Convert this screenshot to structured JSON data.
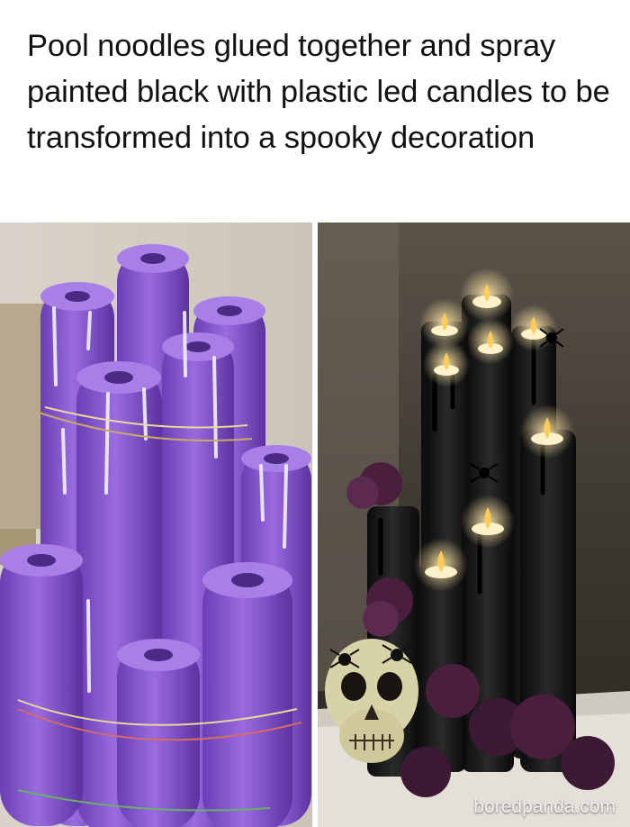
{
  "post": {
    "caption": "Pool noodles glued together and spray painted black with plastic led candles to be transformed into a spooky decoration"
  },
  "photos": {
    "left": {
      "subject": "purple-pool-noodles"
    },
    "right": {
      "subject": "black-candle-decoration"
    }
  },
  "watermark": {
    "text": "boredpanda.com"
  },
  "colors": {
    "noodle_purple": "#8a5ad0",
    "candle_black": "#151515",
    "flame_glow": "#ffd27a"
  }
}
